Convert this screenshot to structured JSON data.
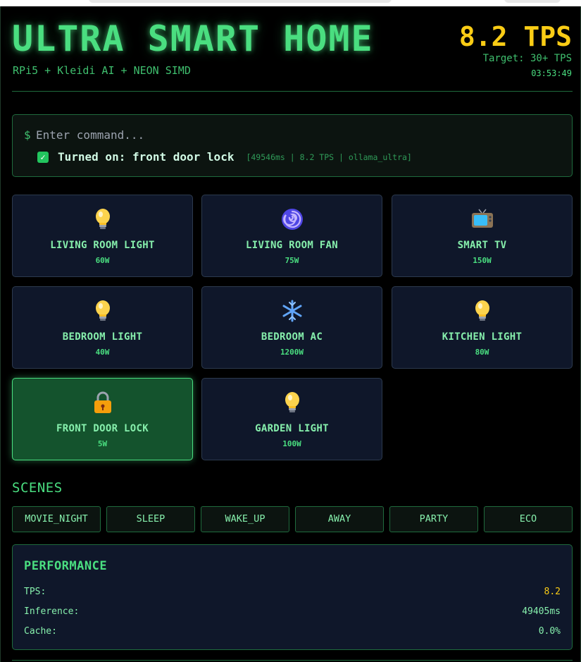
{
  "header": {
    "title": "ULTRA SMART HOME",
    "subtitle": "RPi5 + Kleidi AI + NEON SIMD",
    "tps": "8.2 TPS",
    "target": "Target: 30+ TPS",
    "clock": "03:53:49"
  },
  "command": {
    "prompt_symbol": "$",
    "placeholder": "Enter command...",
    "result_text": "Turned on: front door lock",
    "result_meta": "[49546ms | 8.2 TPS | ollama_ultra]",
    "result_icon": "check-icon"
  },
  "devices": [
    {
      "name": "LIVING ROOM LIGHT",
      "watts": "60W",
      "icon": "lightbulb-icon",
      "active": false
    },
    {
      "name": "LIVING ROOM FAN",
      "watts": "75W",
      "icon": "fan-icon",
      "active": false
    },
    {
      "name": "SMART TV",
      "watts": "150W",
      "icon": "tv-icon",
      "active": false
    },
    {
      "name": "BEDROOM LIGHT",
      "watts": "40W",
      "icon": "lightbulb-icon",
      "active": false
    },
    {
      "name": "BEDROOM AC",
      "watts": "1200W",
      "icon": "snowflake-icon",
      "active": false
    },
    {
      "name": "KITCHEN LIGHT",
      "watts": "80W",
      "icon": "lightbulb-icon",
      "active": false
    },
    {
      "name": "FRONT DOOR LOCK",
      "watts": "5W",
      "icon": "lock-icon",
      "active": true
    },
    {
      "name": "GARDEN LIGHT",
      "watts": "100W",
      "icon": "lightbulb-icon",
      "active": false
    }
  ],
  "scenes": {
    "title": "SCENES",
    "items": [
      "MOVIE_NIGHT",
      "SLEEP",
      "WAKE_UP",
      "AWAY",
      "PARTY",
      "ECO"
    ]
  },
  "performance": {
    "title": "PERFORMANCE",
    "rows": [
      {
        "label": "TPS:",
        "value": "8.2"
      },
      {
        "label": "Inference:",
        "value": "49405ms"
      },
      {
        "label": "Cache:",
        "value": "0.0%"
      }
    ]
  },
  "colors": {
    "accent": "#4ade80",
    "highlight": "#facc15",
    "card_bg": "#0f172a",
    "active_bg": "#14532d"
  }
}
